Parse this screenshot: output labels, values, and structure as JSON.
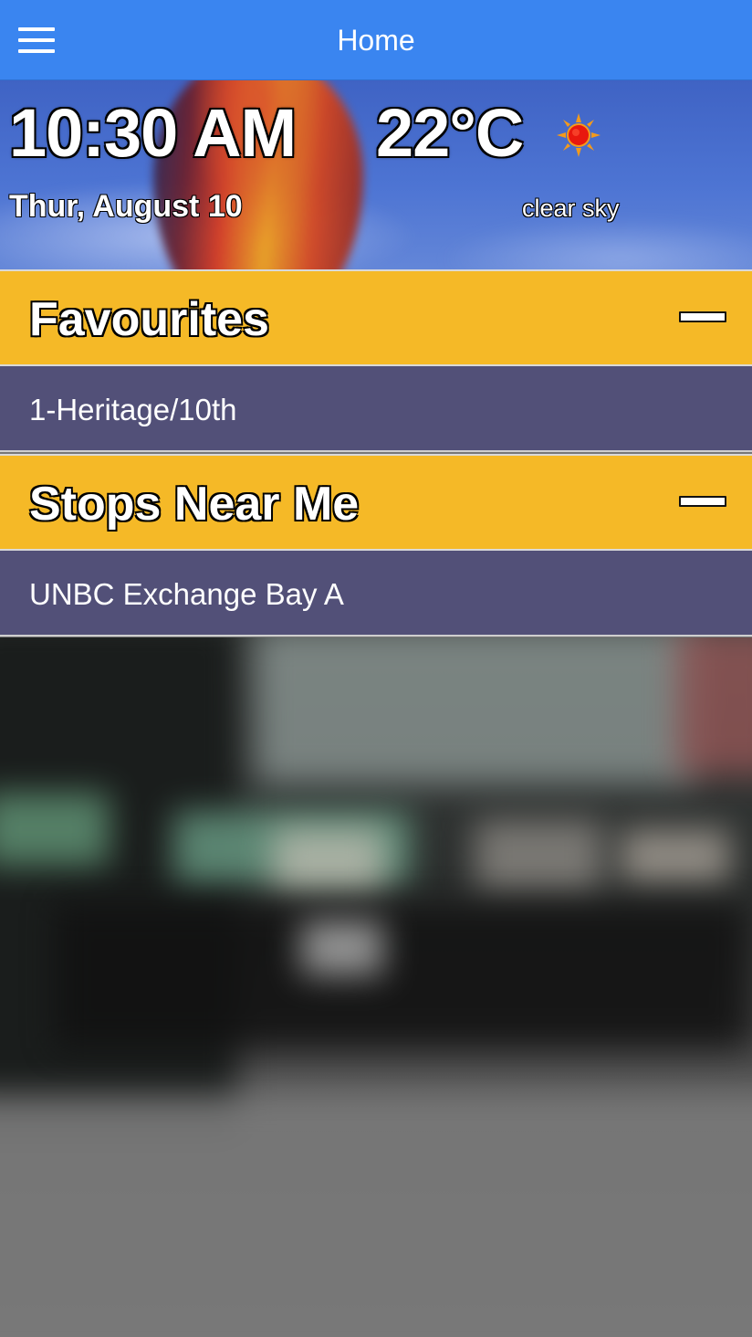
{
  "nav": {
    "title": "Home",
    "menu_icon": "hamburger-menu-icon"
  },
  "weather": {
    "time": "10:30 AM",
    "temperature": "22°C",
    "date": "Thur, August 10",
    "condition": "clear sky",
    "condition_icon": "sun-icon"
  },
  "sections": [
    {
      "title": "Favourites",
      "toggle_icon": "collapse-icon",
      "items": [
        "1-Heritage/10th"
      ]
    },
    {
      "title": "Stops Near Me",
      "toggle_icon": "collapse-icon",
      "items": [
        "UNBC Exchange Bay A"
      ]
    }
  ],
  "colors": {
    "nav_bar": "#3a85f0",
    "section_header": "#f5b927",
    "list_row": "#525078"
  }
}
